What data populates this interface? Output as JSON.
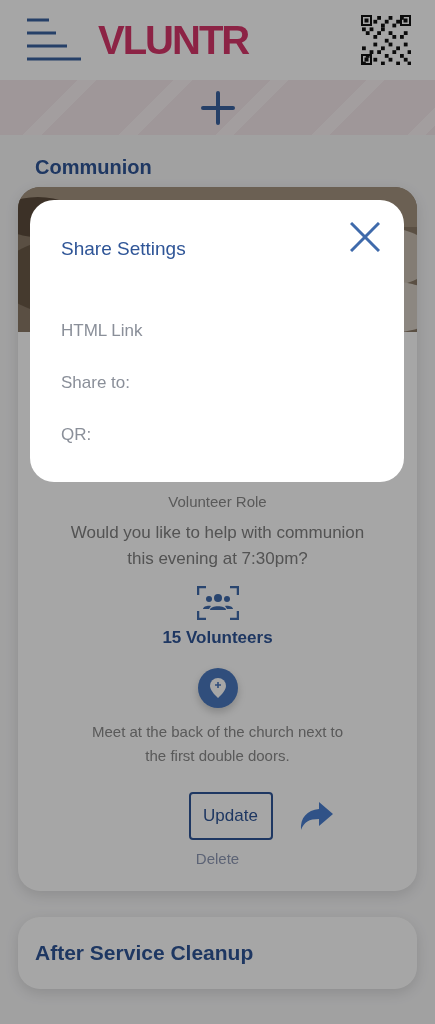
{
  "header": {
    "logo": "VLUNTR"
  },
  "sections": [
    {
      "kind": "expanded",
      "title": "Communion",
      "volunteer_role": "Volunteer Role",
      "question": "Would you like to help with communion this evening at 7:30pm?",
      "count": "15 Volunteers",
      "location": "Meet at the back of the church next to the first double doors.",
      "update": "Update",
      "delete": "Delete"
    },
    {
      "kind": "collapsed",
      "title": "After Service Cleanup"
    }
  ],
  "modal": {
    "title": "Share Settings",
    "fields": [
      "HTML Link",
      "Share to:",
      "QR:"
    ]
  }
}
